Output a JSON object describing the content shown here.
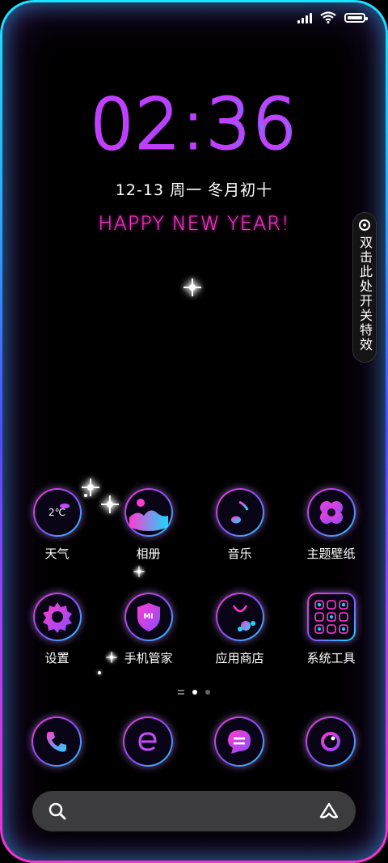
{
  "status_bar": {
    "signal_icon": "signal-bars-icon",
    "wifi_icon": "wifi-icon",
    "battery_icon": "battery-icon"
  },
  "lockscreen": {
    "time": "02:36",
    "date": "12-13  周一   冬月初十",
    "greeting": "HAPPY NEW YEAR!",
    "side_toggle_text": "双击此处开关特效"
  },
  "apps_row1": [
    {
      "label": "天气",
      "icon": "weather-icon",
      "icon_text": "2℃"
    },
    {
      "label": "相册",
      "icon": "gallery-icon"
    },
    {
      "label": "音乐",
      "icon": "music-icon"
    },
    {
      "label": "主题壁纸",
      "icon": "themes-icon"
    }
  ],
  "apps_row2": [
    {
      "label": "设置",
      "icon": "settings-gear-icon"
    },
    {
      "label": "手机管家",
      "icon": "security-shield-icon",
      "icon_text": "MI"
    },
    {
      "label": "应用商店",
      "icon": "app-store-bag-icon"
    },
    {
      "label": "系统工具",
      "icon": "tools-grid-icon"
    }
  ],
  "dock": [
    {
      "name": "phone",
      "icon": "phone-icon"
    },
    {
      "name": "browser",
      "icon": "browser-e-icon"
    },
    {
      "name": "messages",
      "icon": "message-icon"
    },
    {
      "name": "camera",
      "icon": "camera-icon"
    }
  ],
  "pager": {
    "pages": 2,
    "active": 1
  },
  "search_bar": {
    "search_icon": "search-icon",
    "assistant_icon": "assistant-icon"
  },
  "colors": {
    "neon_pink": "#ff3ccf",
    "neon_cyan": "#18d8ff",
    "neon_purple": "#8a4cff"
  }
}
